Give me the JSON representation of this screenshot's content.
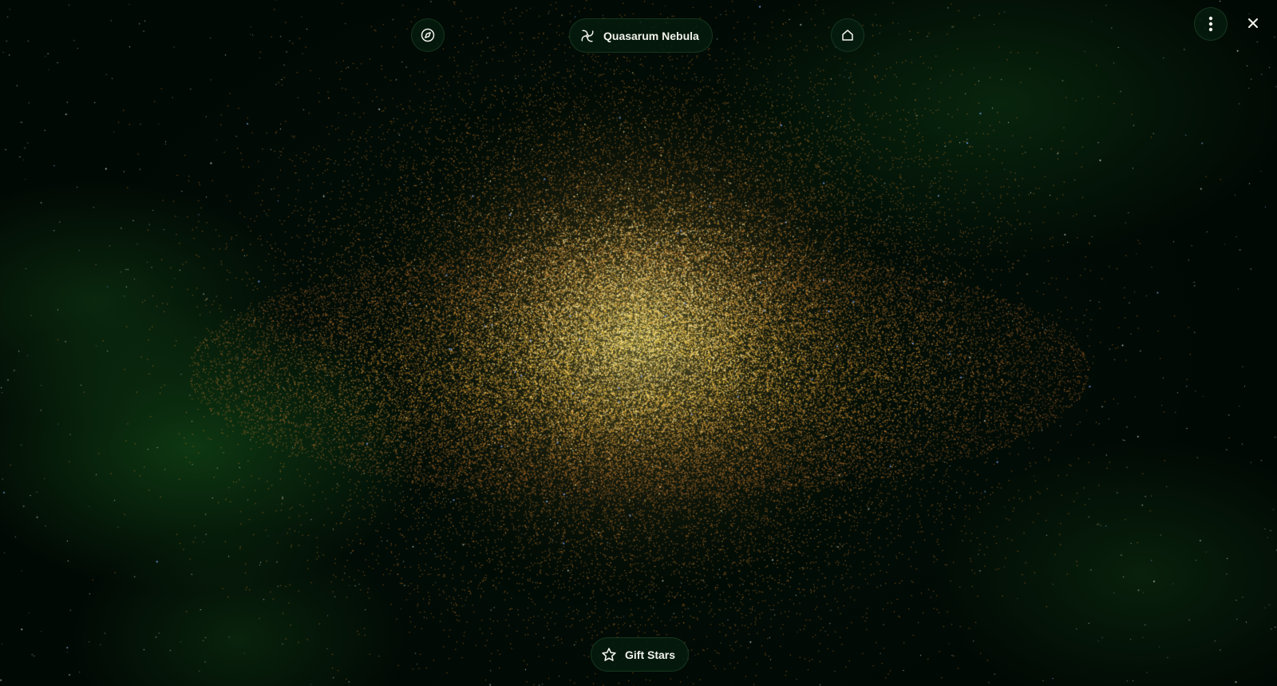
{
  "header": {
    "title": "Quasarum Nebula",
    "title_icon": "galaxy-spiral-icon",
    "left_icon": "compass-icon",
    "right_icon": "home-icon"
  },
  "window_controls": {
    "menu_icon": "more-vertical-icon",
    "close_icon": "close-icon"
  },
  "footer": {
    "gift_label": "Gift Stars",
    "gift_icon": "star-icon"
  },
  "colors": {
    "background": "#020a04",
    "nebula_green": "#124616",
    "galaxy_core": "#ffd870",
    "galaxy_edge": "#e08a3c",
    "button_bg": "#051c0e",
    "text": "#f2f2ea"
  }
}
